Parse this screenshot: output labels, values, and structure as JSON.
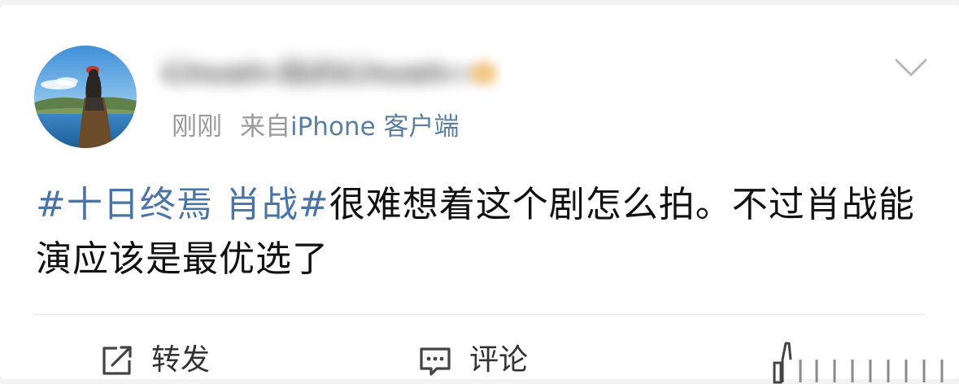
{
  "post": {
    "username": "Chuah 我的Chuah",
    "timestamp": "刚刚",
    "source_prefix": "来自",
    "source_client": "iPhone 客户端",
    "hashtag": "#十日终焉 肖战#",
    "text": "很难想着这个剧怎么拍。不过肖战能演应该是最优选了"
  },
  "actions": {
    "repost_label": "转发",
    "comment_label": "评论"
  },
  "icons": {
    "repost": "share-edit-icon",
    "comment": "comment-bubble-icon",
    "like": "like-thumb-icon",
    "menu": "chevron-down-icon"
  },
  "colors": {
    "link_blue": "#4a74a5",
    "client_blue": "#5b7fa3",
    "meta_gray": "#9a9a9a",
    "text": "#111111"
  }
}
